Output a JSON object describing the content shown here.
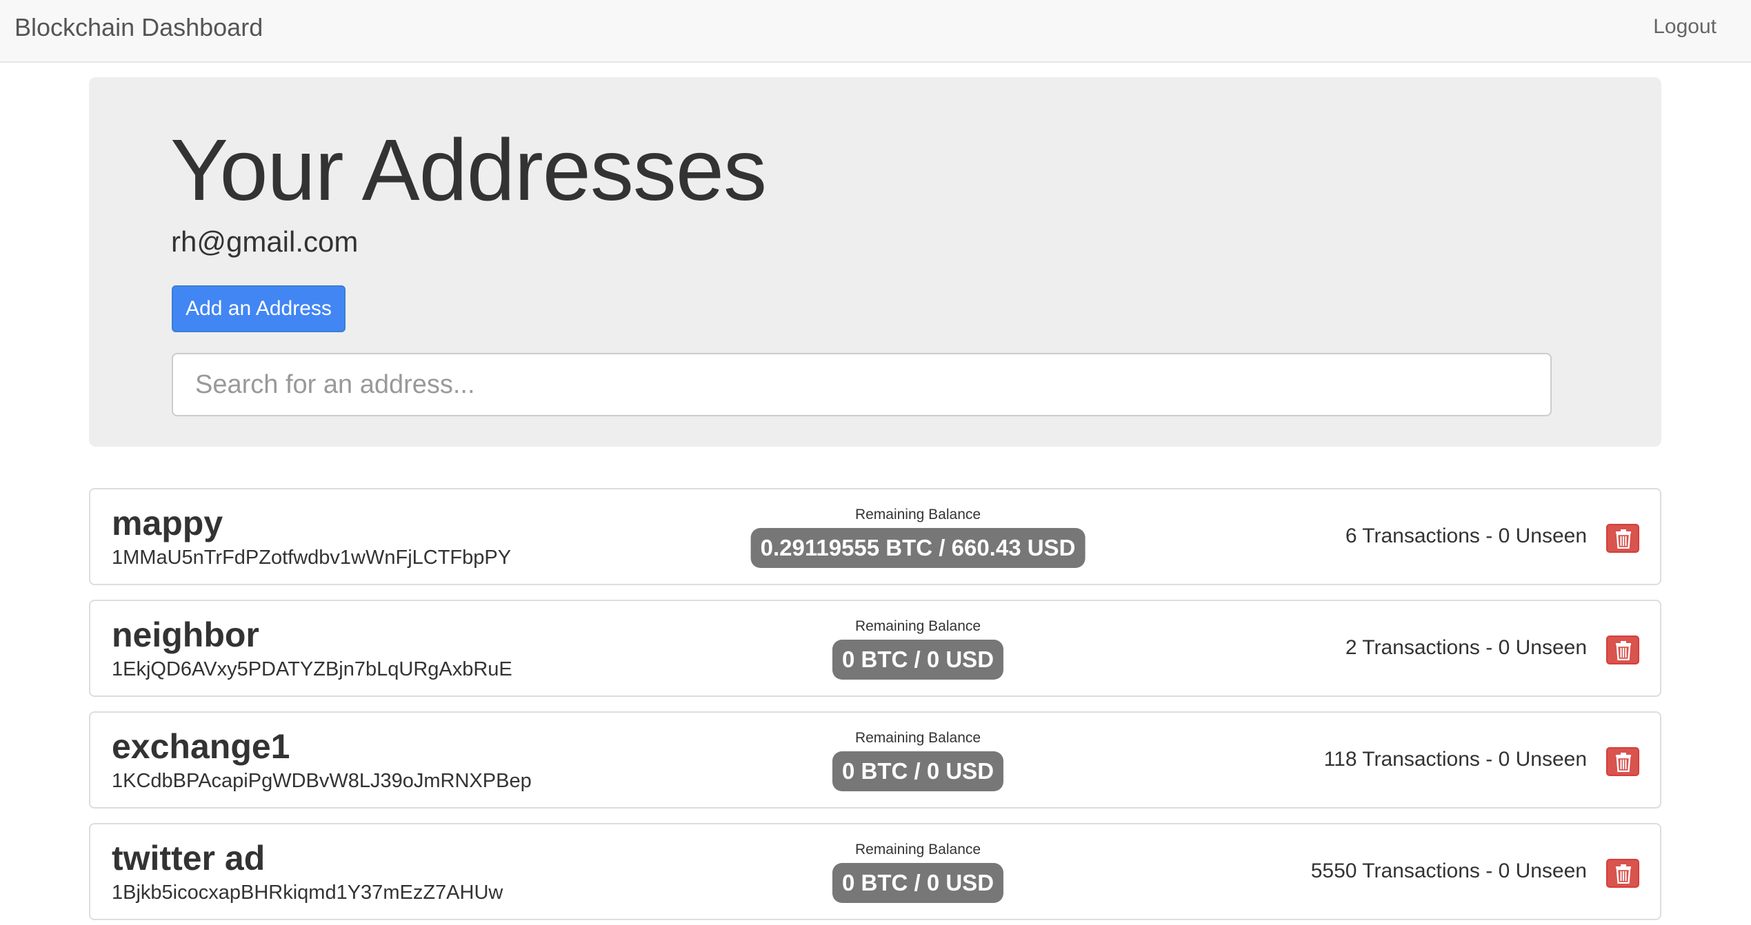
{
  "navbar": {
    "brand": "Blockchain Dashboard",
    "logout_label": "Logout"
  },
  "header": {
    "title": "Your Addresses",
    "email": "rh@gmail.com",
    "add_button_label": "Add an Address",
    "search_placeholder": "Search for an address..."
  },
  "colors": {
    "primary": "#4286f4",
    "danger": "#d9534f",
    "badge": "#777777",
    "jumbotron": "#eeeeee"
  },
  "addresses": [
    {
      "name": "mappy",
      "hash": "1MMaU5nTrFdPZotfwdbv1wWnFjLCTFbpPY",
      "balance_label": "Remaining Balance",
      "balance": "0.29119555 BTC / 660.43 USD",
      "transactions": "6 Transactions - 0 Unseen",
      "delete_icon": "trash-icon"
    },
    {
      "name": "neighbor",
      "hash": "1EkjQD6AVxy5PDATYZBjn7bLqURgAxbRuE",
      "balance_label": "Remaining Balance",
      "balance": "0 BTC / 0 USD",
      "transactions": "2 Transactions - 0 Unseen",
      "delete_icon": "trash-icon"
    },
    {
      "name": "exchange1",
      "hash": "1KCdbBPAcapiPgWDBvW8LJ39oJmRNXPBep",
      "balance_label": "Remaining Balance",
      "balance": "0 BTC / 0 USD",
      "transactions": "118 Transactions - 0 Unseen",
      "delete_icon": "trash-icon"
    },
    {
      "name": "twitter ad",
      "hash": "1Bjkb5icocxapBHRkiqmd1Y37mEzZ7AHUw",
      "balance_label": "Remaining Balance",
      "balance": "0 BTC / 0 USD",
      "transactions": "5550 Transactions - 0 Unseen",
      "delete_icon": "trash-icon"
    }
  ]
}
